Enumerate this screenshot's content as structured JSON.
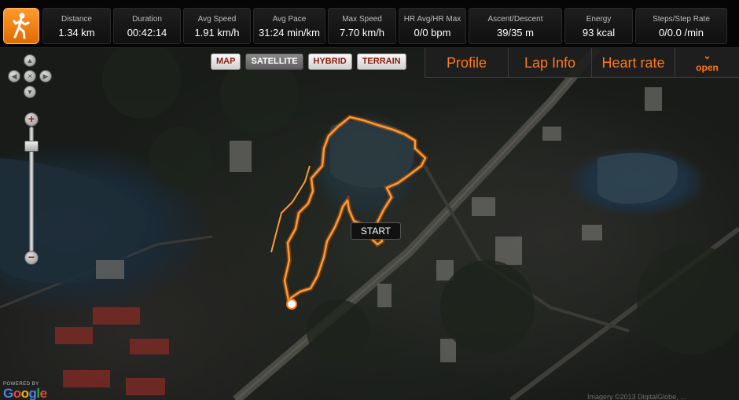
{
  "runner_icon": "runner-icon",
  "stats": [
    {
      "label": "Distance",
      "value": "1.34 km"
    },
    {
      "label": "Duration",
      "value": "00:42:14"
    },
    {
      "label": "Avg Speed",
      "value": "1.91 km/h"
    },
    {
      "label": "Avg Pace",
      "value": "31:24 min/km"
    },
    {
      "label": "Max Speed",
      "value": "7.70 km/h"
    },
    {
      "label": "HR Avg/HR Max",
      "value": "0/0 bpm"
    },
    {
      "label": "Ascent/Descent",
      "value": "39/35 m"
    },
    {
      "label": "Energy",
      "value": "93 kcal"
    },
    {
      "label": "Steps/Step Rate",
      "value": "0/0.0 /min"
    }
  ],
  "map": {
    "types": [
      "MAP",
      "SATELLITE",
      "HYBRID",
      "TERRAIN"
    ],
    "active_type": "SATELLITE",
    "start_label": "START",
    "powered_by": "POWERED BY",
    "google_letters": [
      "G",
      "o",
      "o",
      "g",
      "l",
      "e"
    ],
    "imagery_credit": "Imagery ©2013 DigitalGlobe, ..."
  },
  "tabs": {
    "profile": "Profile",
    "lap_info": "Lap Info",
    "heart_rate": "Heart rate",
    "open": "open"
  },
  "colors": {
    "accent": "#ff7a18",
    "track": "#ff8a1c"
  }
}
